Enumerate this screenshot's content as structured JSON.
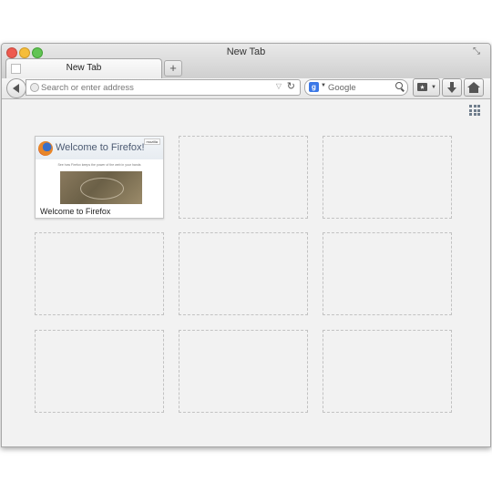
{
  "window": {
    "title": "New Tab"
  },
  "tabs": [
    {
      "label": "New Tab",
      "active": true
    }
  ],
  "toolbar": {
    "url_placeholder": "Search or enter address",
    "search_engine": "Google",
    "search_placeholder": "Google"
  },
  "new_tab_page": {
    "tiles": [
      {
        "title": "Welcome to Firefox",
        "thumbnail": {
          "heading": "Welcome to Firefox!",
          "badge": "mozilla",
          "subtitle": "See how Firefox keeps the power of the web in your hands"
        }
      },
      {
        "title": ""
      },
      {
        "title": ""
      },
      {
        "title": ""
      },
      {
        "title": ""
      },
      {
        "title": ""
      },
      {
        "title": ""
      },
      {
        "title": ""
      },
      {
        "title": ""
      }
    ]
  },
  "icons": [
    "close-icon",
    "minimize-icon",
    "zoom-icon",
    "fullscreen-icon",
    "back-arrow-icon",
    "globe-icon",
    "dropmarker-icon",
    "reload-icon",
    "google-icon",
    "search-icon",
    "bookmarks-icon",
    "downloads-icon",
    "home-icon",
    "grid-toggle-icon"
  ]
}
